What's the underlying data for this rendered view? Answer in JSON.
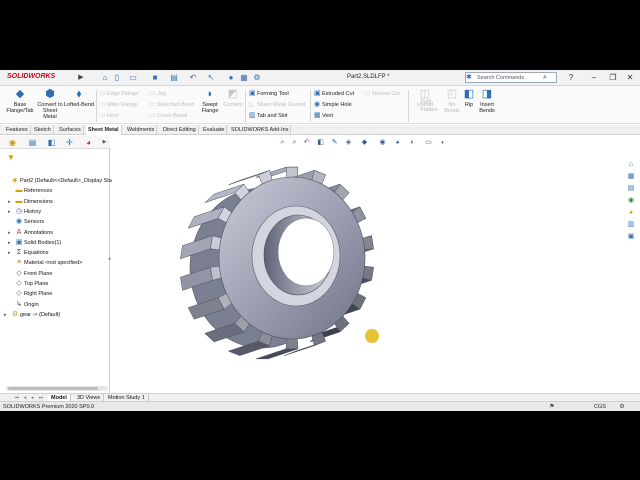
{
  "app": {
    "brand": "SOLIDWORKS",
    "document_title": "Part2.SLDLFP *"
  },
  "search": {
    "placeholder": "Search Commands"
  },
  "commands": {
    "big": [
      {
        "label": "Base Flange/Tab",
        "icon": "base-flange-icon",
        "enabled": true
      },
      {
        "label": "Convert to Sheet Metal",
        "icon": "convert-sheet-metal-icon",
        "enabled": true
      },
      {
        "label": "Lofted-Bend",
        "icon": "lofted-bend-icon",
        "enabled": true
      },
      {
        "label": "Swept Flange",
        "icon": "swept-flange-icon",
        "enabled": true
      },
      {
        "label": "Corners",
        "icon": "corners-icon",
        "enabled": false
      },
      {
        "label": "Unfold",
        "icon": "unfold-icon",
        "enabled": false
      },
      {
        "label": "Fold",
        "icon": "fold-icon",
        "enabled": false
      },
      {
        "label": "Flatten",
        "icon": "flatten-icon",
        "enabled": false
      },
      {
        "label": "No Bends",
        "icon": "no-bends-icon",
        "enabled": false
      },
      {
        "label": "Rip",
        "icon": "rip-icon",
        "enabled": true
      },
      {
        "label": "Insert Bends",
        "icon": "insert-bends-icon",
        "enabled": true
      }
    ],
    "small": [
      {
        "label": "Edge Flange",
        "enabled": false
      },
      {
        "label": "Miter Flange",
        "enabled": false
      },
      {
        "label": "Hem",
        "enabled": false
      },
      {
        "label": "Jog",
        "enabled": false
      },
      {
        "label": "Sketched Bend",
        "enabled": false
      },
      {
        "label": "Cross-Break",
        "enabled": false
      },
      {
        "label": "Forming Tool",
        "enabled": true
      },
      {
        "label": "Sheet Metal Gusset",
        "enabled": false
      },
      {
        "label": "Tab and Slot",
        "enabled": true
      },
      {
        "label": "Extruded Cut",
        "enabled": true
      },
      {
        "label": "Simple Hole",
        "enabled": true
      },
      {
        "label": "Vent",
        "enabled": true
      },
      {
        "label": "Normal Cut",
        "enabled": false
      }
    ]
  },
  "tabs": [
    "Features",
    "Sketch",
    "Surfaces",
    "Sheet Metal",
    "Weldments",
    "Direct Editing",
    "Evaluate",
    "SOLIDWORKS Add-Ins"
  ],
  "active_tab": "Sheet Metal",
  "feature_tree": [
    {
      "label": "Part2  (Default<<Default>_Display Sta",
      "icon": "part-icon",
      "expandable": false,
      "indent": 0
    },
    {
      "label": "References",
      "icon": "folder-icon",
      "expandable": false,
      "indent": 1
    },
    {
      "label": "Dimensions",
      "icon": "folder-icon",
      "expandable": true,
      "indent": 1
    },
    {
      "label": "History",
      "icon": "history-icon",
      "expandable": true,
      "indent": 1
    },
    {
      "label": "Sensors",
      "icon": "sensors-icon",
      "expandable": false,
      "indent": 1
    },
    {
      "label": "Annotations",
      "icon": "annotations-icon",
      "expandable": true,
      "indent": 1
    },
    {
      "label": "Solid Bodies(1)",
      "icon": "solid-bodies-icon",
      "expandable": true,
      "indent": 1
    },
    {
      "label": "Equations",
      "icon": "equations-icon",
      "expandable": true,
      "indent": 1
    },
    {
      "label": "Material <not specified>",
      "icon": "material-icon",
      "expandable": false,
      "indent": 1
    },
    {
      "label": "Front Plane",
      "icon": "plane-icon",
      "expandable": false,
      "indent": 1
    },
    {
      "label": "Top Plane",
      "icon": "plane-icon",
      "expandable": false,
      "indent": 1
    },
    {
      "label": "Right Plane",
      "icon": "plane-icon",
      "expandable": false,
      "indent": 1
    },
    {
      "label": "Origin",
      "icon": "origin-icon",
      "expandable": false,
      "indent": 1
    },
    {
      "label": "gear -> (Default)",
      "icon": "gear-feature-icon",
      "expandable": true,
      "indent": 0
    }
  ],
  "bottom_tabs": [
    "Model",
    "3D Views",
    "Motion Study 1"
  ],
  "active_bottom_tab": "Model",
  "status": {
    "text": "SOLIDWORKS Premium 2020 SP0.0",
    "units": "CGS"
  },
  "colors": {
    "brand_red": "#d0021b",
    "accent_blue": "#2f6db5",
    "gear_steel": "#a9adbf"
  }
}
